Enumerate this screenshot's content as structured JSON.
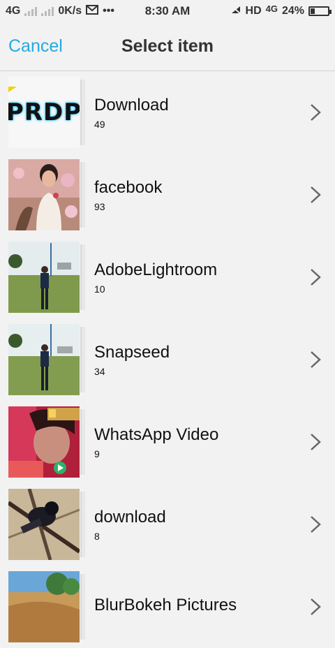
{
  "status_bar": {
    "network_left": "4G",
    "speed": "0K/s",
    "time": "8:30 AM",
    "hd": "HD",
    "network_right": "4G",
    "battery_percent": "24%",
    "battery_level": 0.24
  },
  "header": {
    "cancel_label": "Cancel",
    "title": "Select item"
  },
  "albums": [
    {
      "name": "Download",
      "count": "49",
      "thumb": "prdp",
      "thumb_text": "PRDP"
    },
    {
      "name": "facebook",
      "count": "93",
      "thumb": "portrait-pink"
    },
    {
      "name": "AdobeLightroom",
      "count": "10",
      "thumb": "field-man"
    },
    {
      "name": "Snapseed",
      "count": "34",
      "thumb": "field-man"
    },
    {
      "name": "WhatsApp Video",
      "count": "9",
      "thumb": "video-red"
    },
    {
      "name": "download",
      "count": "8",
      "thumb": "overhead-dark"
    },
    {
      "name": "BlurBokeh Pictures",
      "count": "",
      "thumb": "landscape"
    }
  ],
  "colors": {
    "accent": "#25a9e0",
    "background": "#f2f2f2"
  }
}
